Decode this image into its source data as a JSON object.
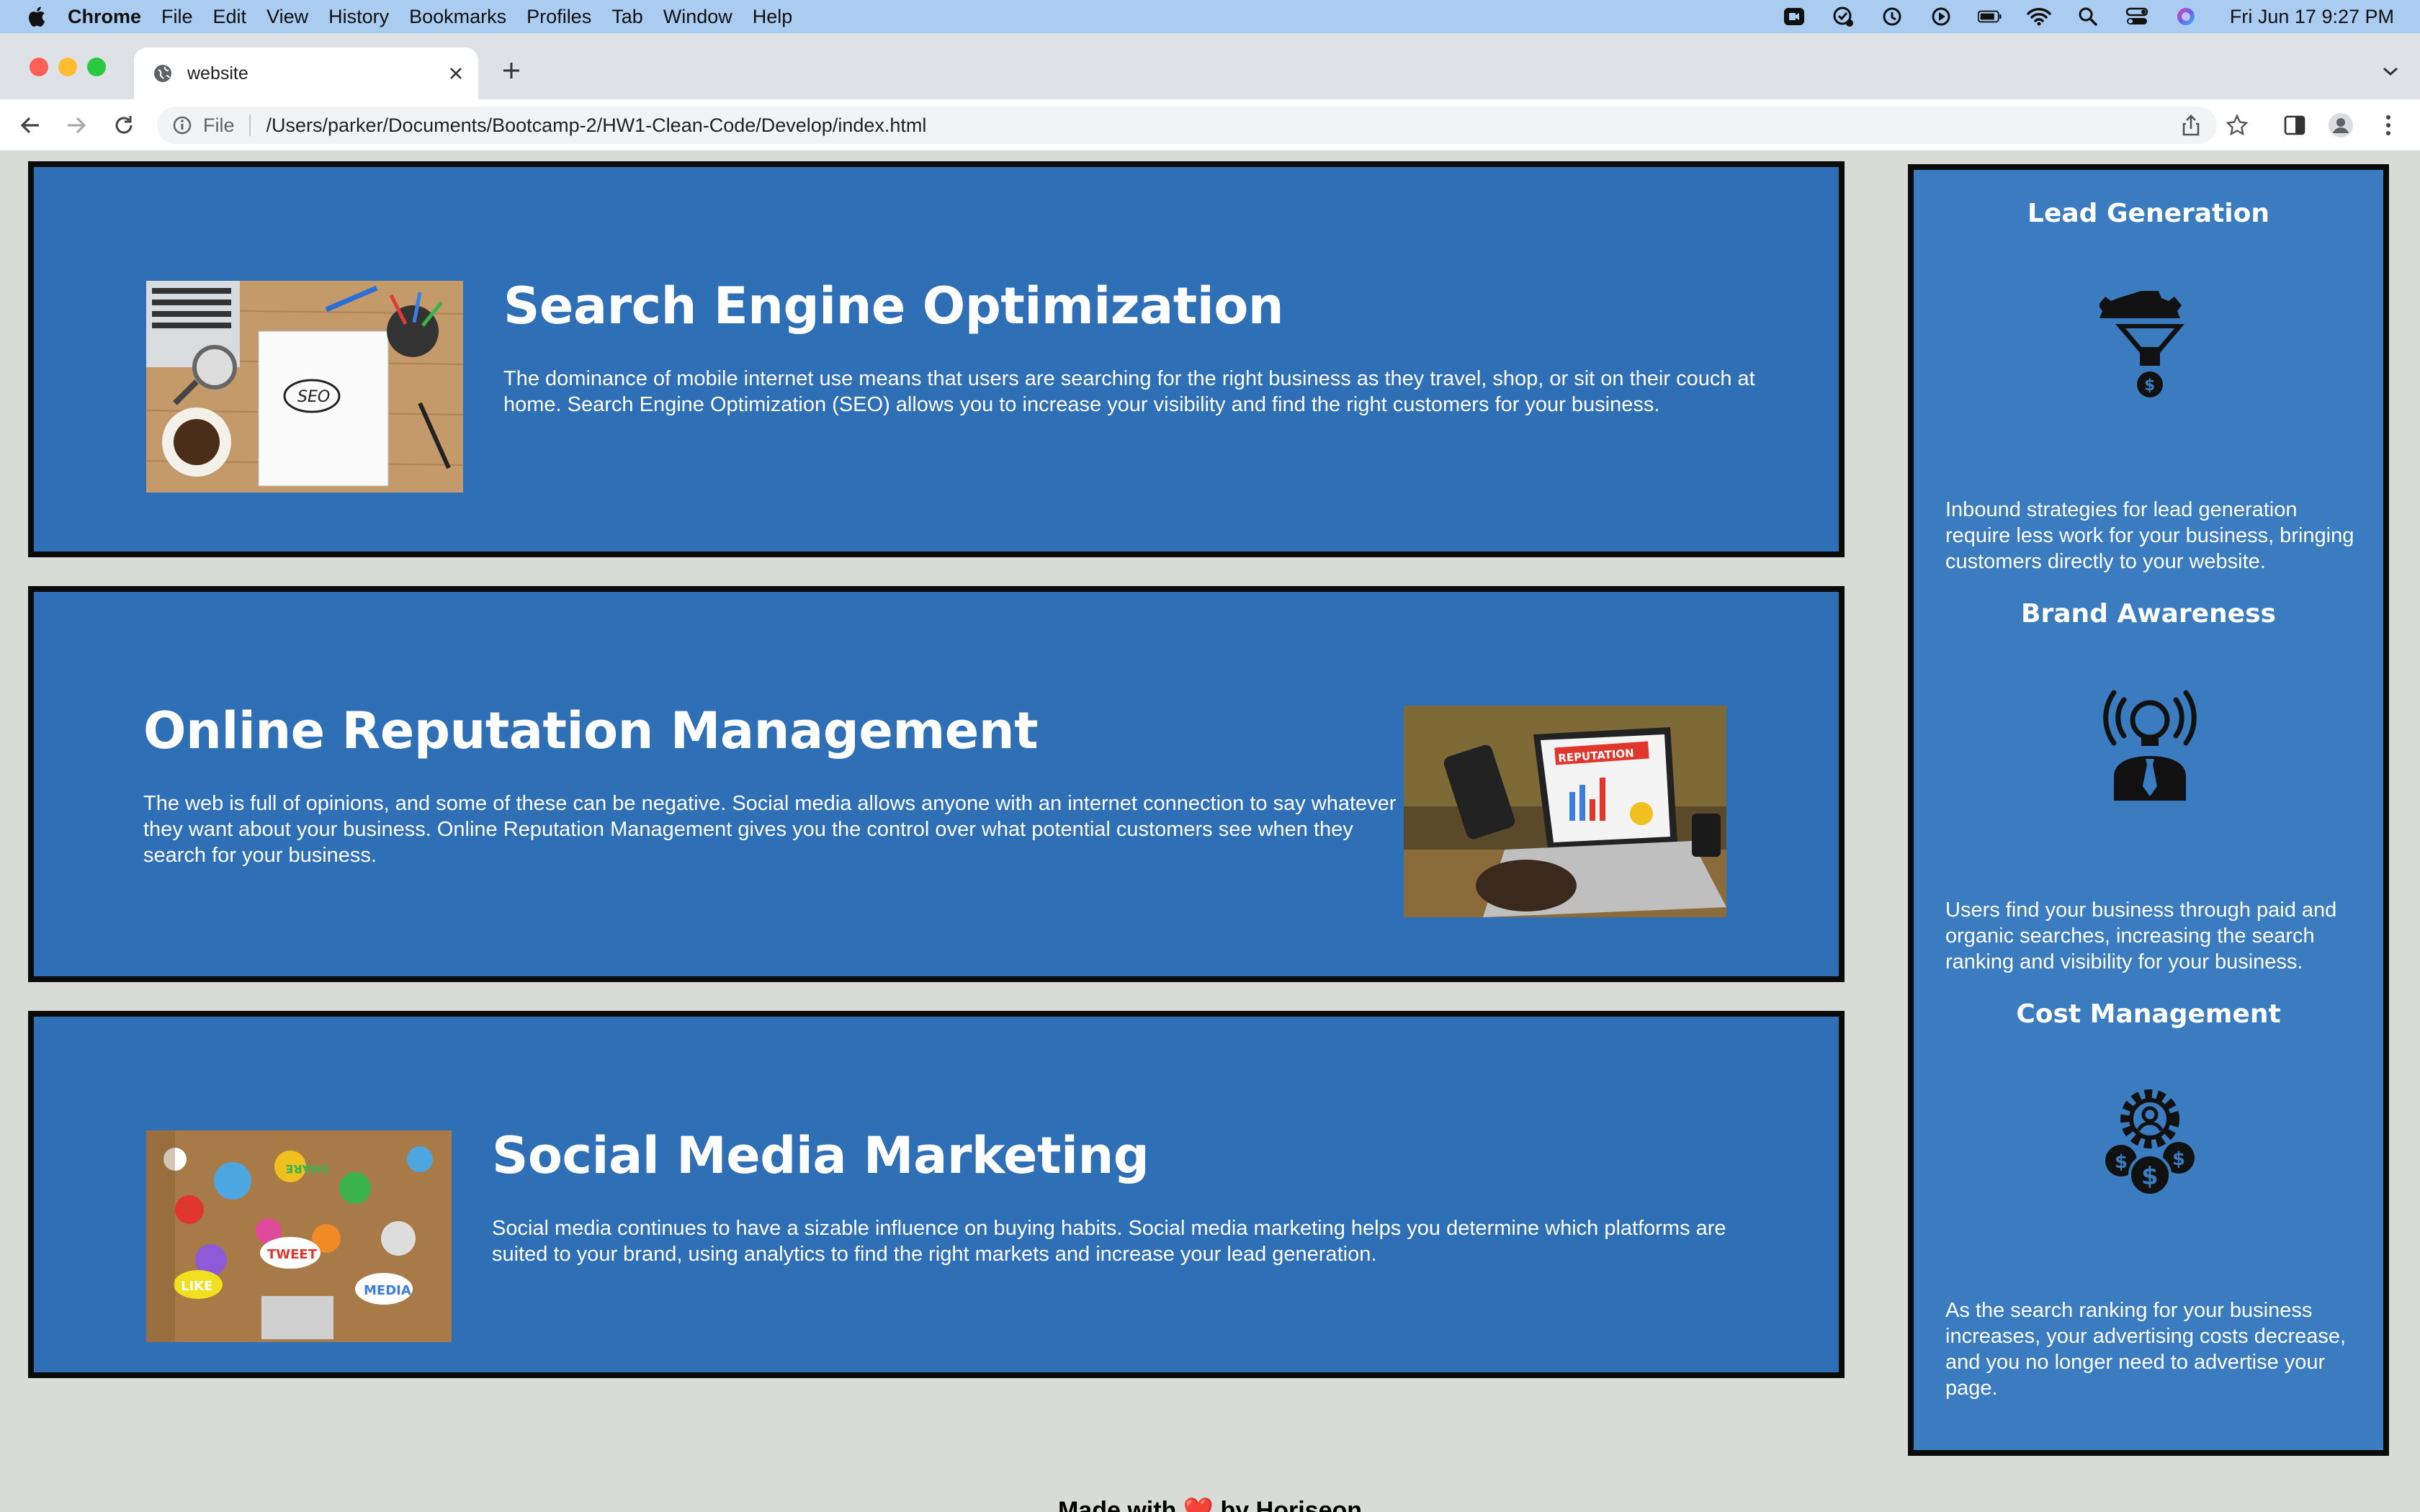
{
  "menubar": {
    "app": "Chrome",
    "items": [
      "File",
      "Edit",
      "View",
      "History",
      "Bookmarks",
      "Profiles",
      "Tab",
      "Window",
      "Help"
    ],
    "clock": "Fri Jun 17  9:27 PM"
  },
  "browser": {
    "tab_title": "website",
    "scheme_label": "File",
    "url": "/Users/parker/Documents/Bootcamp-2/HW1-Clean-Code/Develop/index.html"
  },
  "colors": {
    "card_bg": "#2f6fb5",
    "aside_bg": "#3a7cbf",
    "page_bg": "#d9dbd6",
    "border": "#0b0b0b"
  },
  "content": {
    "cards": [
      {
        "title": "Search Engine Optimization",
        "text": "The dominance of mobile internet use means that users are searching for the right business as they travel, shop, or sit on their couch at home. Search Engine Optimization (SEO) allows you to increase your visibility and find the right customers for your business.",
        "image_label": "SEO"
      },
      {
        "title": "Online Reputation Management",
        "text": "The web is full of opinions, and some of these can be negative. Social media allows anyone with an internet connection to say whatever they want about your business. Online Reputation Management gives you the control over what potential customers see when they search for your business.",
        "image_label": "REPUTATION"
      },
      {
        "title": "Social Media Marketing",
        "text": "Social media continues to have a sizable influence on buying habits. Social media marketing helps you determine which platforms are suited to your brand, using analytics to find the right markets and increase your lead generation.",
        "image_labels": [
          "LIKE",
          "TWEET",
          "MEDIA",
          "SHARE"
        ]
      }
    ],
    "benefits": [
      {
        "title": "Lead Generation",
        "text": "Inbound strategies for lead generation require less work for your business, bringing customers directly to your website.",
        "icon": "lead-funnel-icon"
      },
      {
        "title": "Brand Awareness",
        "text": "Users find your business through paid and organic searches, increasing the search ranking and visibility for your business.",
        "icon": "brand-bulb-icon"
      },
      {
        "title": "Cost Management",
        "text": "As the search ranking for your business increases, your advertising costs decrease, and you no longer need to advertise your page.",
        "icon": "cost-gear-icon"
      }
    ],
    "footer": "Made with ❤️ by Horiseon"
  }
}
